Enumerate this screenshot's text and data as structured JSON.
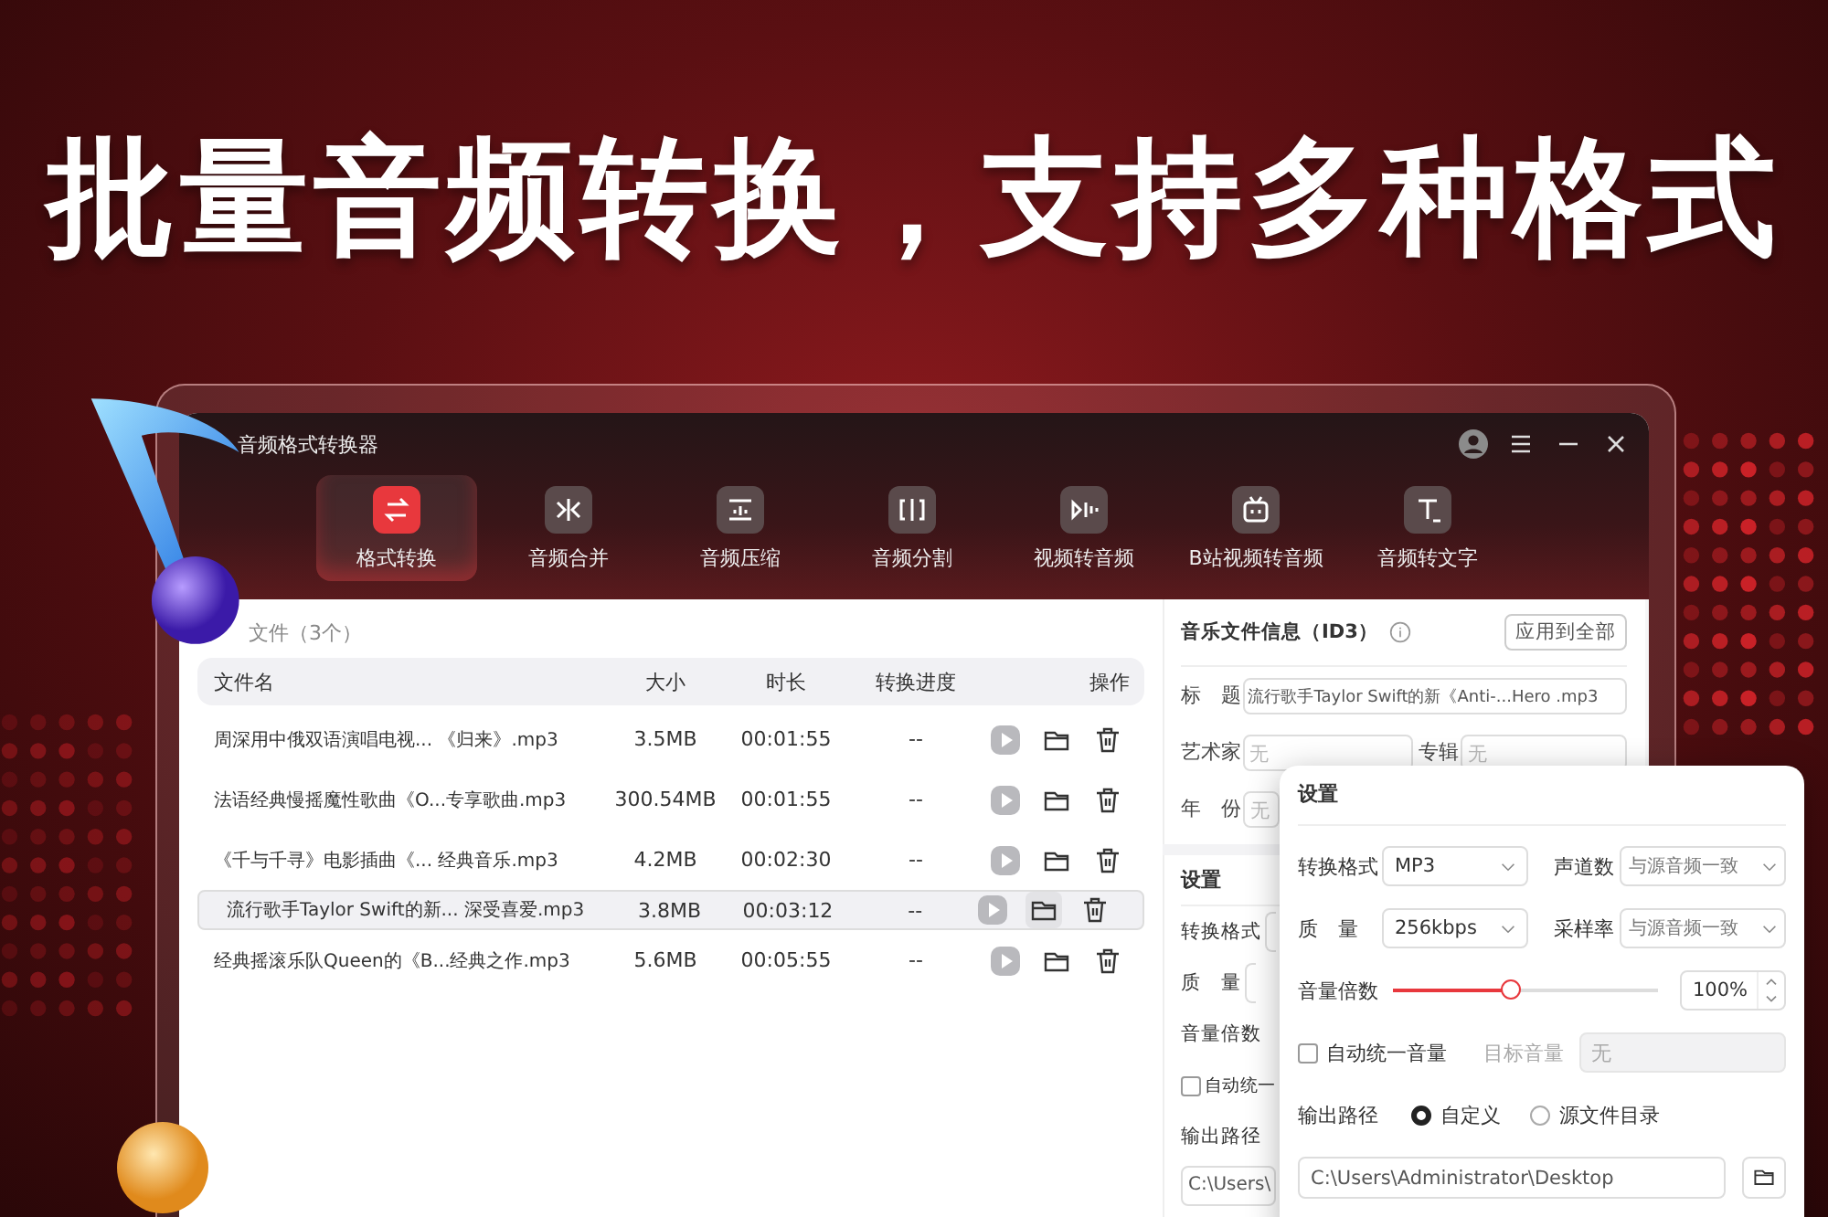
{
  "headline": "批量音频转换，支持多种格式",
  "window": {
    "title": "音频格式转换器"
  },
  "tools": [
    {
      "label": "格式转换",
      "kind": "convert",
      "selected": true
    },
    {
      "label": "音频合并",
      "kind": "merge",
      "selected": false
    },
    {
      "label": "音频压缩",
      "kind": "compress",
      "selected": false
    },
    {
      "label": "音频分割",
      "kind": "split",
      "selected": false
    },
    {
      "label": "视频转音频",
      "kind": "video",
      "selected": false
    },
    {
      "label": "B站视频转音频",
      "kind": "tv",
      "selected": false
    },
    {
      "label": "音频转文字",
      "kind": "text",
      "selected": false
    }
  ],
  "file_list": {
    "heading": "文件（3个）",
    "columns": [
      "文件名",
      "大小",
      "时长",
      "转换进度",
      "操作"
    ],
    "rows": [
      {
        "name": "周深用中俄双语演唱电视... 《归来》.mp3",
        "size": "3.5MB",
        "duration": "00:01:55",
        "progress": "--",
        "selected": false
      },
      {
        "name": "法语经典慢摇魔性歌曲《O...专享歌曲.mp3",
        "size": "300.54MB",
        "duration": "00:01:55",
        "progress": "--",
        "selected": false
      },
      {
        "name": "《千与千寻》电影插曲《... 经典音乐.mp3",
        "size": "4.2MB",
        "duration": "00:02:30",
        "progress": "--",
        "selected": false
      },
      {
        "name": "流行歌手Taylor Swift的新... 深受喜爱.mp3",
        "size": "3.8MB",
        "duration": "00:03:12",
        "progress": "--",
        "selected": true
      },
      {
        "name": "经典摇滚乐队Queen的《B...经典之作.mp3",
        "size": "5.6MB",
        "duration": "00:05:55",
        "progress": "--",
        "selected": false
      }
    ]
  },
  "id3": {
    "title": "音乐文件信息（ID3）",
    "apply_button": "应用到全部",
    "title_label": "标　题",
    "title_value": "流行歌手Taylor Swift的新《Anti-...Hero .mp3",
    "artist_label": "艺术家",
    "artist_placeholder": "无",
    "album_label": "专辑",
    "album_placeholder": "无",
    "year_label": "年　份",
    "year_placeholder": "无"
  },
  "back_settings": {
    "title": "设置",
    "format_label": "转换格式",
    "quality_label": "质　量",
    "volume_label": "音量倍数",
    "auto_label": "自动统一",
    "auto_checked": false,
    "output_label": "输出路径",
    "path_value": "C:\\Users\\"
  },
  "settings": {
    "title": "设置",
    "format_label": "转换格式",
    "format_value": "MP3",
    "channels_label": "声道数",
    "channels_value": "与源音频一致",
    "quality_label": "质　量",
    "quality_value": "256kbps",
    "rate_label": "采样率",
    "rate_value": "与源音频一致",
    "volume_label": "音量倍数",
    "level": 0.45,
    "volume_value": "100%",
    "auto_label": "自动统一音量",
    "auto_checked": false,
    "target_label": "目标音量",
    "target_placeholder": "无",
    "output_label": "输出路径",
    "output_options": [
      {
        "label": "自定义",
        "selected": true
      },
      {
        "label": "源文件目录",
        "selected": false
      }
    ],
    "path_value": "C:\\Users\\Administrator\\Desktop"
  }
}
